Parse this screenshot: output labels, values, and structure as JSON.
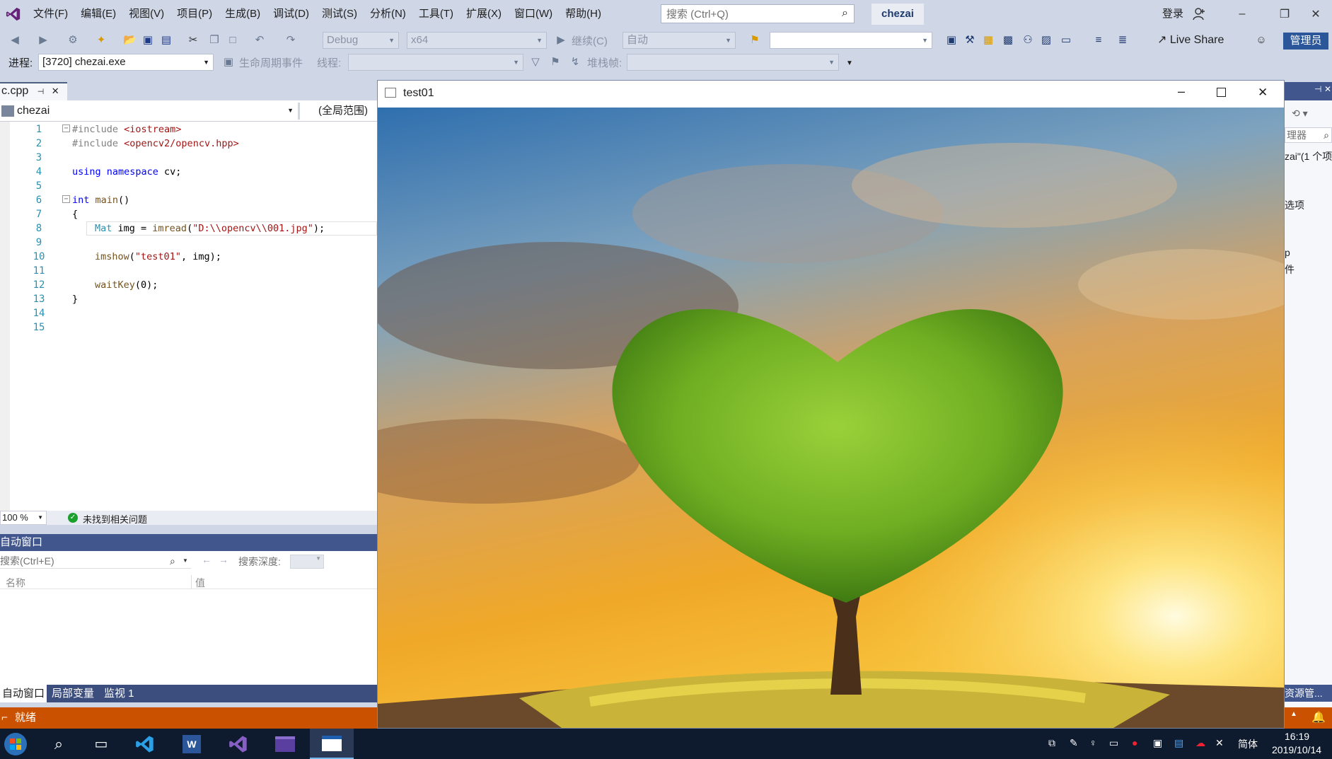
{
  "menubar": {
    "items": [
      "文件(F)",
      "编辑(E)",
      "视图(V)",
      "项目(P)",
      "生成(B)",
      "调试(D)",
      "测试(S)",
      "分析(N)",
      "工具(T)",
      "扩展(X)",
      "窗口(W)",
      "帮助(H)"
    ],
    "search_placeholder": "搜索 (Ctrl+Q)",
    "solution_name": "chezai",
    "login": "登录"
  },
  "toolbar": {
    "config": "Debug",
    "platform": "x64",
    "continue": "继续(C)",
    "auto": "自动",
    "live_share": "Live Share",
    "admin": "管理员"
  },
  "debugbar": {
    "process_label": "进程:",
    "process_value": "[3720] chezai.exe",
    "lifecycle": "生命周期事件",
    "thread_label": "线程:",
    "stackframe_label": "堆栈帧:"
  },
  "editor": {
    "tab": "c.cpp",
    "project": "chezai",
    "scope": "(全局范围)",
    "zoom": "100 %",
    "issues": "未找到相关问题",
    "line_numbers": [
      "1",
      "2",
      "3",
      "4",
      "5",
      "6",
      "7",
      "8",
      "9",
      "10",
      "11",
      "12",
      "13",
      "14",
      "15"
    ]
  },
  "autos": {
    "title": "自动窗口",
    "search_placeholder": "搜索(Ctrl+E)",
    "depth_label": "搜索深度:",
    "col_name": "名称",
    "col_value": "值",
    "tabs": [
      "自动窗口",
      "局部变量",
      "监视 1"
    ]
  },
  "status": {
    "ready": "就绪"
  },
  "right_panel": {
    "label_solution": "理器",
    "label_chezai": "zai\"(1 个项",
    "label_options": "选项",
    "label_p": "p",
    "label_file": "件",
    "label_explorer": "资源管..."
  },
  "image_window": {
    "title": "test01"
  },
  "taskbar": {
    "ime": "简体",
    "time": "16:19",
    "date": "2019/10/14"
  },
  "colors": {
    "vs_purple": "#68217a",
    "status_orange": "#ca5100",
    "tool_window_blue": "#40568d",
    "chrome_bg": "#cfd6e5"
  }
}
